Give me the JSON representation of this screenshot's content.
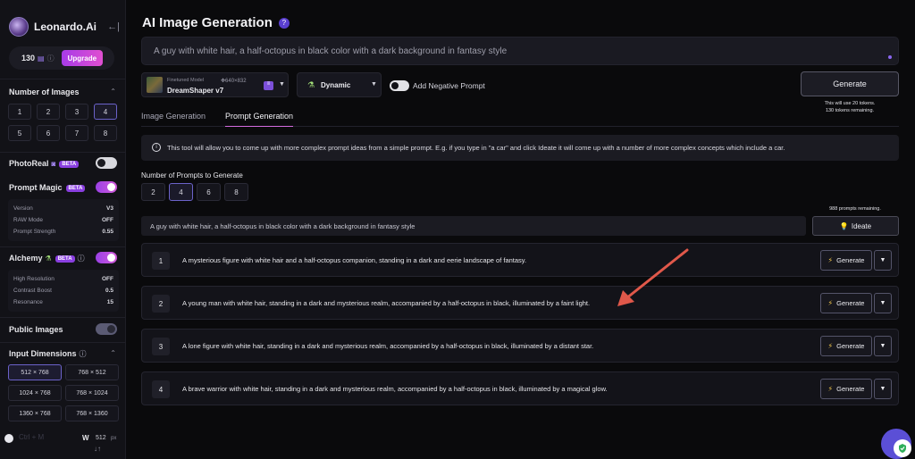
{
  "app": {
    "logo_text": "Leonardo.Ai",
    "collapse_icon": "←|",
    "tokens": "130",
    "upgrade_label": "Upgrade"
  },
  "sidebar": {
    "number_of_images": {
      "label": "Number of Images",
      "options": [
        "1",
        "2",
        "3",
        "4",
        "5",
        "6",
        "7",
        "8"
      ],
      "selected": "4"
    },
    "photoreal": {
      "label": "PhotoReal",
      "badge": "BETA",
      "enabled": false
    },
    "prompt_magic": {
      "label": "Prompt Magic",
      "badge": "BETA",
      "enabled": true,
      "rows": [
        {
          "label": "Version",
          "value": "V3"
        },
        {
          "label": "RAW Mode",
          "value": "OFF"
        },
        {
          "label": "Prompt Strength",
          "value": "0.55"
        }
      ]
    },
    "alchemy": {
      "label": "Alchemy",
      "badge": "BETA",
      "enabled": true,
      "rows": [
        {
          "label": "High Resolution",
          "value": "OFF"
        },
        {
          "label": "Contrast Boost",
          "value": "0.5"
        },
        {
          "label": "Resonance",
          "value": "15"
        }
      ]
    },
    "public_images": {
      "label": "Public Images",
      "enabled": true
    },
    "input_dimensions": {
      "label": "Input Dimensions",
      "options": [
        "512 × 768",
        "768 × 512",
        "1024 × 768",
        "768 × 1024",
        "1360 × 768",
        "768 × 1360"
      ],
      "selected": "512 × 768"
    },
    "width": {
      "label": "W",
      "value": "512",
      "unit": "px"
    },
    "ghost_label": "Ctrl + M"
  },
  "main": {
    "title": "AI Image Generation",
    "prompt": "A guy with white hair, a half-octopus in black color with a dark background in fantasy style",
    "model": {
      "kicker": "Finetuned Model",
      "resolution": "640×832",
      "name": "DreamShaper v7"
    },
    "style": {
      "label": "Dynamic"
    },
    "negative_prompt_label": "Add Negative Prompt",
    "generate_label": "Generate",
    "token_note_line1": "This will use 20 tokens.",
    "token_note_line2": "130 tokens remaining.",
    "tabs": [
      {
        "label": "Image Generation",
        "active": false
      },
      {
        "label": "Prompt Generation",
        "active": true
      }
    ],
    "notice": "This tool will allow you to come up with more complex prompt ideas from a simple prompt. E.g. if you type in \"a car\" and click Ideate it will come up with a number of more complex concepts which include a car.",
    "num_prompts": {
      "label": "Number of Prompts to Generate",
      "options": [
        "2",
        "4",
        "6",
        "8"
      ],
      "selected": "4"
    },
    "prompts_remaining": "988 prompts remaining.",
    "seed_prompt": "A guy with white hair, a half-octopus in black color with a dark background in fantasy style",
    "ideate_label": "Ideate",
    "results": [
      {
        "num": "1",
        "text": "A mysterious figure with white hair and a half-octopus companion, standing in a dark and eerie landscape of fantasy."
      },
      {
        "num": "2",
        "text": "A young man with white hair, standing in a dark and mysterious realm, accompanied by a half-octopus in black, illuminated by a faint light."
      },
      {
        "num": "3",
        "text": "A lone figure with white hair, standing in a dark and mysterious realm, accompanied by a half-octopus in black, illuminated by a distant star."
      },
      {
        "num": "4",
        "text": "A brave warrior with white hair, standing in a dark and mysterious realm, accompanied by a half-octopus in black, illuminated by a magical glow."
      }
    ],
    "result_generate_label": "Generate"
  },
  "colors": {
    "accent": "#d25ad8",
    "arrow": "#e0584a",
    "selected_border": "#6b62c9"
  }
}
